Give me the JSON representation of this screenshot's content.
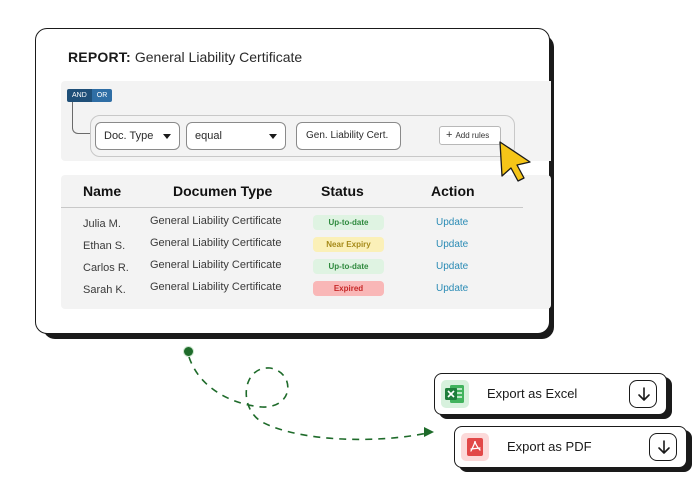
{
  "report": {
    "label": "REPORT:",
    "title": "General Liability Certificate"
  },
  "filter": {
    "and_label": "AND",
    "or_label": "OR",
    "field": "Doc. Type",
    "operator": "equal",
    "value": "Gen. Liability Cert.",
    "add_rules": "Add rules"
  },
  "table": {
    "headers": {
      "name": "Name",
      "type": "Documen Type",
      "status": "Status",
      "action": "Action"
    },
    "rows": [
      {
        "name": "Julia M.",
        "type": "General Liability Certificate",
        "status": "Up-to-date",
        "action": "Update"
      },
      {
        "name": "Ethan S.",
        "type": "General Liability Certificate",
        "status": "Near Expiry",
        "action": "Update"
      },
      {
        "name": "Carlos R.",
        "type": "General Liability Certificate",
        "status": "Up-to-date",
        "action": "Update"
      },
      {
        "name": "Sarah K.",
        "type": "General Liability Certificate",
        "status": "Expired",
        "action": "Update"
      }
    ]
  },
  "export": {
    "excel_label": "Export as Excel",
    "pdf_label": "Export as PDF"
  },
  "icons": {
    "cursor": "pointer-cursor-icon",
    "excel": "excel-icon",
    "pdf": "pdf-icon",
    "download": "download-arrow-icon"
  },
  "colors": {
    "accent": "#2f6ea5",
    "link": "#2a8bb5",
    "status_up_to_date": "#dff3e2",
    "status_near_expiry": "#fbf0b8",
    "status_expired": "#f9b7b7",
    "cursor": "#f5c518",
    "connector": "#1e6b2a"
  }
}
